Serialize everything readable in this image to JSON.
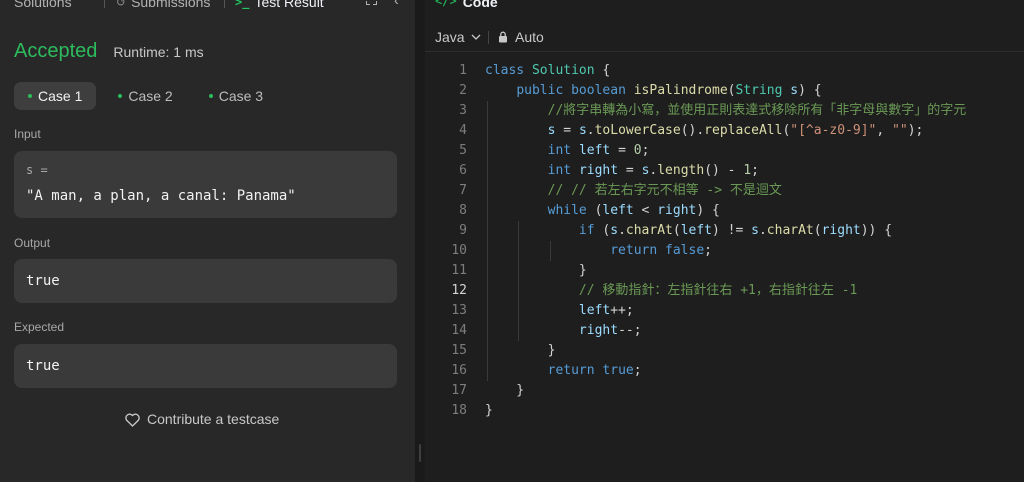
{
  "tabs": {
    "solutions": "Solutions",
    "submissions": "Submissions",
    "test_result": "Test Result"
  },
  "result": {
    "status": "Accepted",
    "runtime": "Runtime: 1 ms"
  },
  "cases": [
    {
      "label": "Case 1",
      "active": true
    },
    {
      "label": "Case 2",
      "active": false
    },
    {
      "label": "Case 3",
      "active": false
    }
  ],
  "input": {
    "label": "Input",
    "var_name": "s =",
    "value": "\"A man, a plan, a canal: Panama\""
  },
  "output": {
    "label": "Output",
    "value": "true"
  },
  "expected": {
    "label": "Expected",
    "value": "true"
  },
  "contribute_label": "Contribute a testcase",
  "code_panel": {
    "title": "Code",
    "language": "Java",
    "mode": "Auto",
    "current_line": 12,
    "lines": [
      "class Solution {",
      "    public boolean isPalindrome(String s) {",
      "        //將字串轉為小寫，並使用正則表達式移除所有「非字母與數字」的字元",
      "        s = s.toLowerCase().replaceAll(\"[^a-z0-9]\", \"\");",
      "        int left = 0;",
      "        int right = s.length() - 1;",
      "        // // 若左右字元不相等 -> 不是迴文",
      "        while (left < right) {",
      "            if (s.charAt(left) != s.charAt(right)) {",
      "                return false;",
      "            }",
      "            // 移動指針：左指針往右 +1，右指針往左 -1",
      "            left++;",
      "            right--;",
      "        }",
      "        return true;",
      "    }",
      "}"
    ]
  }
}
